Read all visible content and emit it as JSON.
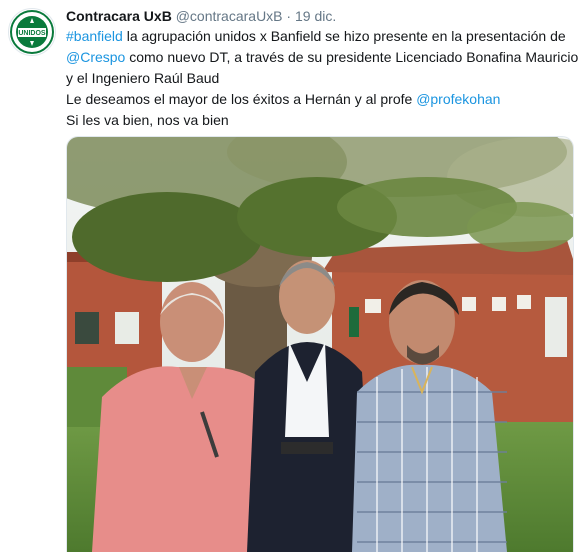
{
  "tweet": {
    "author_name": "Contracara UxB",
    "handle": "@contracaraUxB",
    "separator": "·",
    "date": "19 dic.",
    "avatar_text": "UNIDOS",
    "text": {
      "hashtag": "#banfield",
      "line1_rest": " la agrupación unidos x Banfield se hizo presente en la presentación de",
      "mention_crespo": "@Crespo",
      "line2_rest": " como nuevo DT, a través de su presidente Licenciado Bonafina Mauricio",
      "line3": "y el Ingeniero Raúl Baud",
      "line4_start": "Le deseamos el mayor de los éxitos a Hernán y al profe ",
      "mention_profe": "@profekohan",
      "line5": "Si les va bien, nos va bien"
    }
  },
  "colors": {
    "link": "#1b95e0",
    "muted": "#657786",
    "text": "#14171a",
    "club_green": "#0a7a3c"
  }
}
